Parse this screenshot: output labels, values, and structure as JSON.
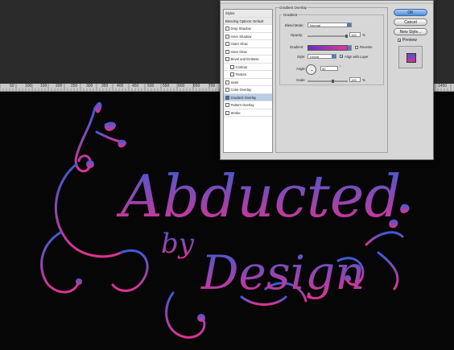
{
  "ruler": {
    "ticks": [
      "50",
      "100",
      "150",
      "200",
      "250",
      "300",
      "350",
      "400",
      "450",
      "500",
      "550",
      "600",
      "650",
      "700",
      "750",
      "800",
      "850",
      "900",
      "950",
      "1000",
      "1050",
      "1100",
      "1150",
      "1200",
      "1250",
      "1300",
      "1350",
      "1400",
      "1450"
    ]
  },
  "artwork": {
    "line1": "Abducted",
    "line2": "by",
    "line3": "Design",
    "color_top": "#3b5bd6",
    "color_bottom": "#e0338f"
  },
  "dialog": {
    "styles_list": [
      {
        "label": "Styles",
        "kind": "header"
      },
      {
        "label": "Blending Options: Default",
        "kind": "header"
      },
      {
        "label": "Drop Shadow",
        "checked": false
      },
      {
        "label": "Inner Shadow",
        "checked": false
      },
      {
        "label": "Outer Glow",
        "checked": false
      },
      {
        "label": "Inner Glow",
        "checked": false
      },
      {
        "label": "Bevel and Emboss",
        "checked": false
      },
      {
        "label": "Contour",
        "checked": false,
        "indent": true
      },
      {
        "label": "Texture",
        "checked": false,
        "indent": true
      },
      {
        "label": "Satin",
        "checked": false
      },
      {
        "label": "Color Overlay",
        "checked": false
      },
      {
        "label": "Gradient Overlay",
        "checked": true,
        "selected": true
      },
      {
        "label": "Pattern Overlay",
        "checked": false
      },
      {
        "label": "Stroke",
        "checked": false
      }
    ],
    "panel_title": "Gradient Overlay",
    "subpanel_title": "Gradient",
    "blend_mode_label": "Blend Mode:",
    "blend_mode_value": "Normal",
    "opacity_label": "Opacity:",
    "opacity_value": "100",
    "percent": "%",
    "gradient_label": "Gradient:",
    "reverse_label": "Reverse",
    "style_label": "Style:",
    "style_value": "Linear",
    "align_label": "Align with Layer",
    "angle_label": "Angle:",
    "angle_value": "90",
    "degree": "°",
    "scale_label": "Scale:",
    "scale_value": "100",
    "gradient_colors": [
      "#6d2fc0",
      "#d83b9a"
    ],
    "buttons": {
      "ok": "OK",
      "cancel": "Cancel",
      "new_style": "New Style..."
    },
    "preview_label": "Preview"
  }
}
